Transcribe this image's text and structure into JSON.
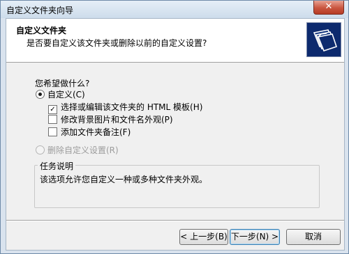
{
  "window": {
    "title": "自定义文件夹向导",
    "close_glyph": "✕"
  },
  "header": {
    "title": "自定义文件夹",
    "subtitle": "是否要自定义该文件夹或删除以前的自定义设置?"
  },
  "question": "您希望做什么?",
  "options": {
    "customize": {
      "label": "自定义(C)",
      "selected": true
    },
    "html_template": {
      "label": "选择或编辑该文件夹的 HTML 模板(H)",
      "checked": true,
      "check_glyph": "✓"
    },
    "background": {
      "label": "修改背景图片和文件名外观(P)",
      "checked": false
    },
    "comment": {
      "label": "添加文件夹备注(F)",
      "checked": false
    },
    "remove": {
      "label": "删除自定义设置(R)",
      "selected": false,
      "disabled": true
    }
  },
  "task_group": {
    "legend": "任务说明",
    "text": "该选项允许您自定义一种或多种文件夹外观。"
  },
  "buttons": {
    "back": "< 上一步(B)",
    "next": "下一步(N) >",
    "cancel": "取消"
  },
  "colors": {
    "logo_bg": "#0d2a6e",
    "close_bg": "#c9553f"
  }
}
